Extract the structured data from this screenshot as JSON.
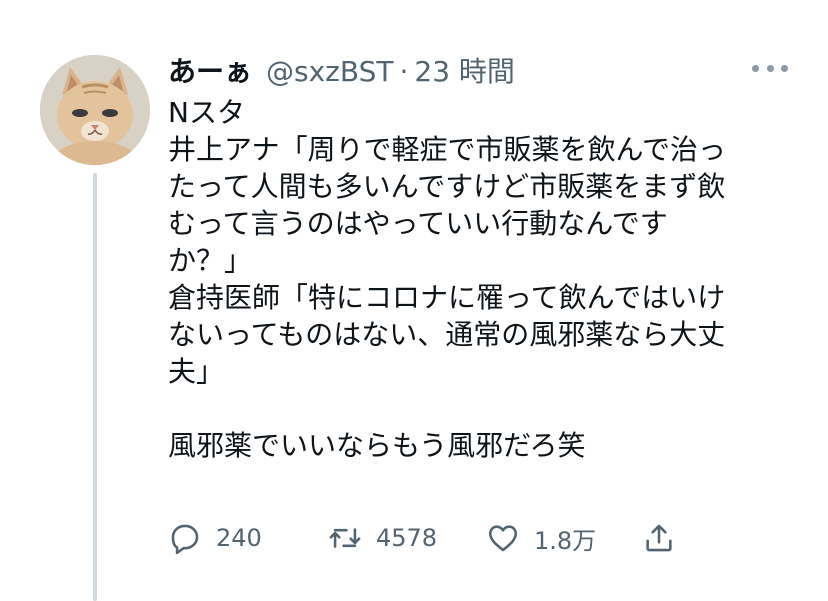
{
  "tweet": {
    "display_name": "あーぁ",
    "handle": "@sxzBST",
    "separator": "·",
    "timestamp": "23 時間",
    "lines": [
      "Nスタ",
      "井上アナ「周りで軽症で市販薬を飲んで治っ",
      "たって人間も多いんですけど市販薬をまず飲",
      "むって言うのはやっていい行動なんです",
      "か？」",
      "倉持医師「特にコロナに罹って飲んではいけ",
      "ないってものはない、通常の風邪薬なら大丈",
      "夫」",
      "",
      "風邪薬でいいならもう風邪だろ笑"
    ]
  },
  "actions": {
    "reply": {
      "icon": "reply-icon",
      "count": "240"
    },
    "retweet": {
      "icon": "retweet-icon",
      "count": "4578"
    },
    "like": {
      "icon": "heart-icon",
      "count": "1.8万"
    },
    "share": {
      "icon": "share-icon"
    }
  },
  "colors": {
    "text": "#0f1419",
    "secondary": "#536471",
    "thread_line": "#cfd9de"
  }
}
